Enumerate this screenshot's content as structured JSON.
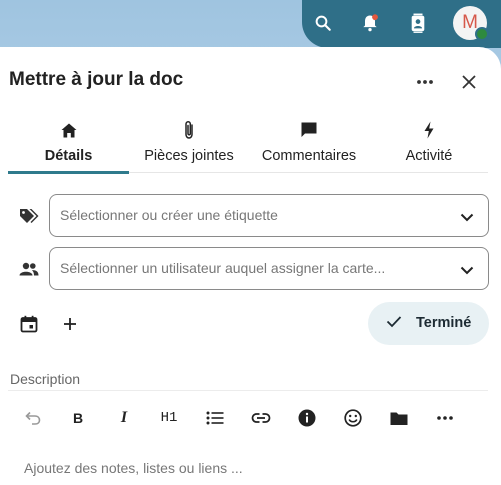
{
  "topbar": {
    "search_icon": "search-icon",
    "bell_icon": "bell-icon",
    "contacts_icon": "contacts-icon",
    "avatar_initial": "M",
    "accent": "#2f6f88",
    "notification_dot": "#e4573d"
  },
  "panel": {
    "title": "Mettre à jour la doc",
    "more_icon": "more-horizontal-icon",
    "close_icon": "close-icon"
  },
  "tabs": [
    {
      "label": "Détails",
      "icon": "home-icon",
      "active": true
    },
    {
      "label": "Pièces jointes",
      "icon": "paperclip-icon",
      "active": false
    },
    {
      "label": "Commentaires",
      "icon": "comment-icon",
      "active": false
    },
    {
      "label": "Activité",
      "icon": "bolt-icon",
      "active": false
    }
  ],
  "fields": {
    "tags_placeholder": "Sélectionner ou créer une étiquette",
    "assign_placeholder": "Sélectionner un utilisateur auquel assigner la carte..."
  },
  "actions": {
    "done_label": "Terminé",
    "done_bg": "#e8f1f4"
  },
  "description": {
    "label": "Description",
    "h1_label": "H1",
    "bold_label": "B",
    "italic_label": "I",
    "placeholder": "Ajoutez des notes, listes ou liens ..."
  }
}
